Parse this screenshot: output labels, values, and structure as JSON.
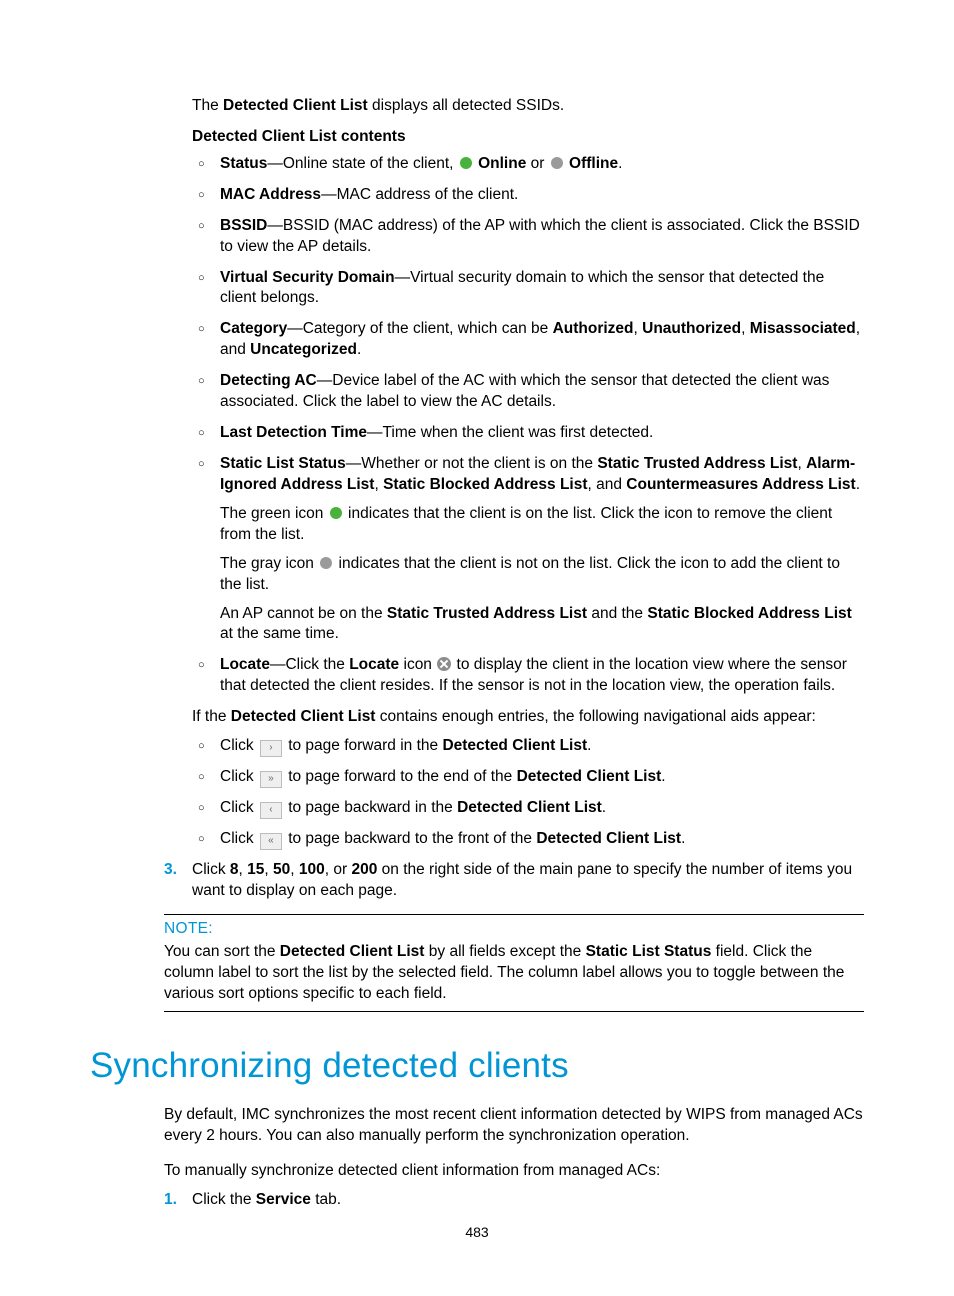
{
  "intro": {
    "line1_a": "The ",
    "line1_b": "Detected Client List",
    "line1_c": " displays all detected SSIDs.",
    "subhead": "Detected Client List contents"
  },
  "items": {
    "status": {
      "term": "Status",
      "desc_a": "—Online state of the client, ",
      "online": "Online",
      "or": " or ",
      "offline": "Offline",
      "end": "."
    },
    "mac": {
      "term": "MAC Address",
      "desc": "—MAC address of the client."
    },
    "bssid": {
      "term": "BSSID",
      "desc": "—BSSID (MAC address) of the AP with which the client is associated. Click the BSSID to view the AP details."
    },
    "vsd": {
      "term": "Virtual Security Domain",
      "desc": "—Virtual security domain to which the sensor that detected the client belongs."
    },
    "cat": {
      "term": "Category",
      "a": "—Category of the client, which can be ",
      "b1": "Authorized",
      "c1": ", ",
      "b2": "Unauthorized",
      "c2": ", ",
      "b3": "Misassociated",
      "c3": ", and ",
      "b4": "Uncategorized",
      "end": "."
    },
    "dac": {
      "term": "Detecting AC",
      "desc": "—Device label of the AC with which the sensor that detected the client was associated. Click the label to view the AC details."
    },
    "ldt": {
      "term": "Last Detection Time",
      "desc": "—Time when the client was first detected."
    },
    "sls": {
      "term": "Static List Status",
      "a": "—Whether or not the client is on the ",
      "l1": "Static Trusted Address List",
      "c1": ", ",
      "l2": "Alarm-Ignored Address List",
      "c2": ", ",
      "l3": "Static Blocked Address List",
      "c3": ", and ",
      "l4": "Countermeasures Address List",
      "end": ".",
      "green_a": "The green icon ",
      "green_b": " indicates that the client is on the list. Click the icon to remove the client from the list.",
      "gray_a": "The gray icon ",
      "gray_b": " indicates that the client is not on the list. Click the icon to add the client to the list.",
      "ap_a": "An AP cannot be on the ",
      "ap_l1": "Static Trusted Address List",
      "ap_mid": " and the ",
      "ap_l2": "Static Blocked Address List",
      "ap_end": " at the same time."
    },
    "loc": {
      "term": "Locate",
      "a": "—Click the ",
      "b": "Locate",
      "c": " icon ",
      "d": " to display the client in the location view where the sensor that detected the client resides. If the sensor is not in the location view, the operation fails."
    }
  },
  "nav": {
    "intro_a": "If the ",
    "intro_b": "Detected Client List",
    "intro_c": " contains enough entries, the following navigational aids appear:",
    "n1a": "Click ",
    "n1g": "›",
    "n1b": " to page forward in the ",
    "n1c": "Detected Client List",
    "n1d": ".",
    "n2a": "Click ",
    "n2g": "»",
    "n2b": " to page forward to the end of the ",
    "n2c": "Detected Client List",
    "n2d": ".",
    "n3a": "Click ",
    "n3g": "‹",
    "n3b": " to page backward in the ",
    "n3c": "Detected Client List",
    "n3d": ".",
    "n4a": "Click ",
    "n4g": "«",
    "n4b": " to page backward to the front of the ",
    "n4c": "Detected Client List",
    "n4d": "."
  },
  "step3": {
    "num": "3.",
    "a": "Click ",
    "b1": "8",
    "c1": ", ",
    "b2": "15",
    "c2": ", ",
    "b3": "50",
    "c3": ", ",
    "b4": "100",
    "c4": ", or ",
    "b5": "200",
    "d": " on the right side of the main pane to specify the number of items you want to display on each page."
  },
  "note": {
    "label": "NOTE:",
    "a": "You can sort the ",
    "b": "Detected Client List",
    "c": " by all fields except the ",
    "d": "Static List Status",
    "e": " field. Click the column label to sort the list by the selected field. The column label allows you to toggle between the various sort options specific to each field."
  },
  "section": {
    "heading": "Synchronizing detected clients",
    "p1": "By default, IMC synchronizes the most recent client information detected by WIPS from managed ACs every 2 hours. You can also manually perform the synchronization operation.",
    "p2": "To manually synchronize detected client information from managed ACs:",
    "s1num": "1.",
    "s1a": "Click the ",
    "s1b": "Service",
    "s1c": " tab."
  },
  "footer": {
    "page": "483"
  }
}
